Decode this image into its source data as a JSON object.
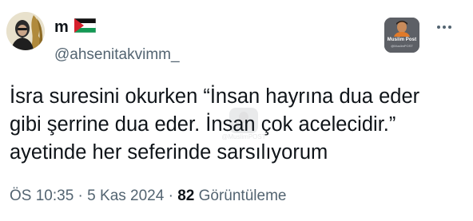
{
  "user": {
    "display_name": "m",
    "handle": "@ahsenitakvimm_"
  },
  "brand": {
    "logo_title": "Muslim Post",
    "logo_subtitle": "@MuslimPOST",
    "watermark_text": "@MuslimPOST"
  },
  "icons": {
    "flag": "palestine-flag-icon",
    "more": "more-options-icon"
  },
  "tweet": {
    "lines": [
      "İsra suresini okurken “İnsan hayrına dua eder",
      "gibi şerrine dua eder. İnsan çok acelecidir.”",
      "ayetinde her seferinde sarsılıyorum"
    ]
  },
  "meta": {
    "time": "ÖS 10:35",
    "separator": " · ",
    "date": "5 Kas 2024",
    "views_count": "82",
    "views_label": "Görüntüleme"
  },
  "colors": {
    "text_primary": "#0f1419",
    "text_secondary": "#536471",
    "flag_red": "#d6202c",
    "flag_green": "#149954"
  }
}
